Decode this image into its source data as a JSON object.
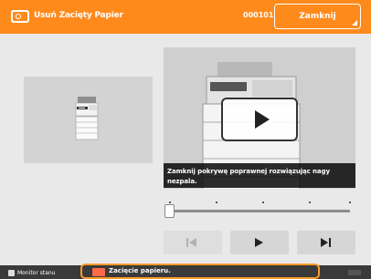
{
  "header": {
    "title": "Usuń Zacięty Papier",
    "code": "000101",
    "close_label": "Zamknij",
    "accent_color": "#ff8a1c"
  },
  "video": {
    "caption": "Zamknij pokrywę poprawnej rozwiązując nagy nezpala.",
    "play_icon": "play-icon"
  },
  "controls": {
    "prev_icon": "skip-back-icon",
    "play_icon": "play-icon",
    "next_icon": "skip-forward-icon",
    "progress": 0.0
  },
  "statusbar": {
    "monitor_label": "Monitor stanu",
    "notice_text": "Zacięcie papieru."
  }
}
